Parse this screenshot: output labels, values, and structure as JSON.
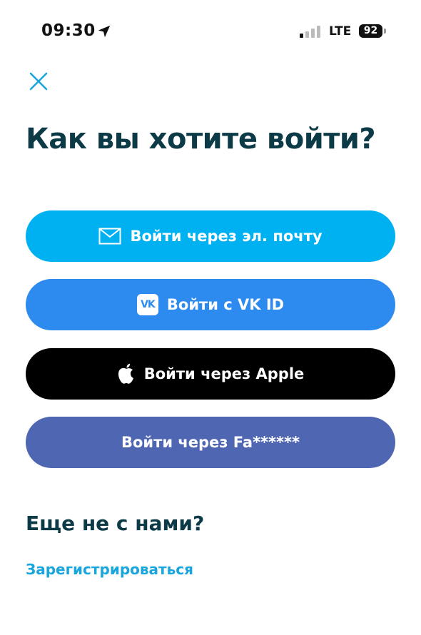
{
  "status_bar": {
    "time": "09:30",
    "network": "LTE",
    "battery": "92"
  },
  "title": "Как вы хотите войти?",
  "buttons": {
    "email": "Войти через эл. почту",
    "vk": "Войти с VK ID",
    "apple": "Войти через Apple",
    "facebook": "Войти через Fa******"
  },
  "vk_icon_text": "VK",
  "signup": {
    "title": "Еще не с нами?",
    "link": "Зарегистрироваться"
  },
  "colors": {
    "accent": "#00b1f1",
    "vk": "#2d8bf0",
    "apple": "#000000",
    "facebook": "#4f66b3",
    "heading": "#0d3a47",
    "link": "#19a6dd"
  },
  "icons": {
    "status": [
      "location-arrow-icon",
      "signal-icon",
      "battery-icon"
    ],
    "close": "close-icon",
    "email": "envelope-icon",
    "vk": "vk-icon",
    "apple": "apple-icon"
  }
}
